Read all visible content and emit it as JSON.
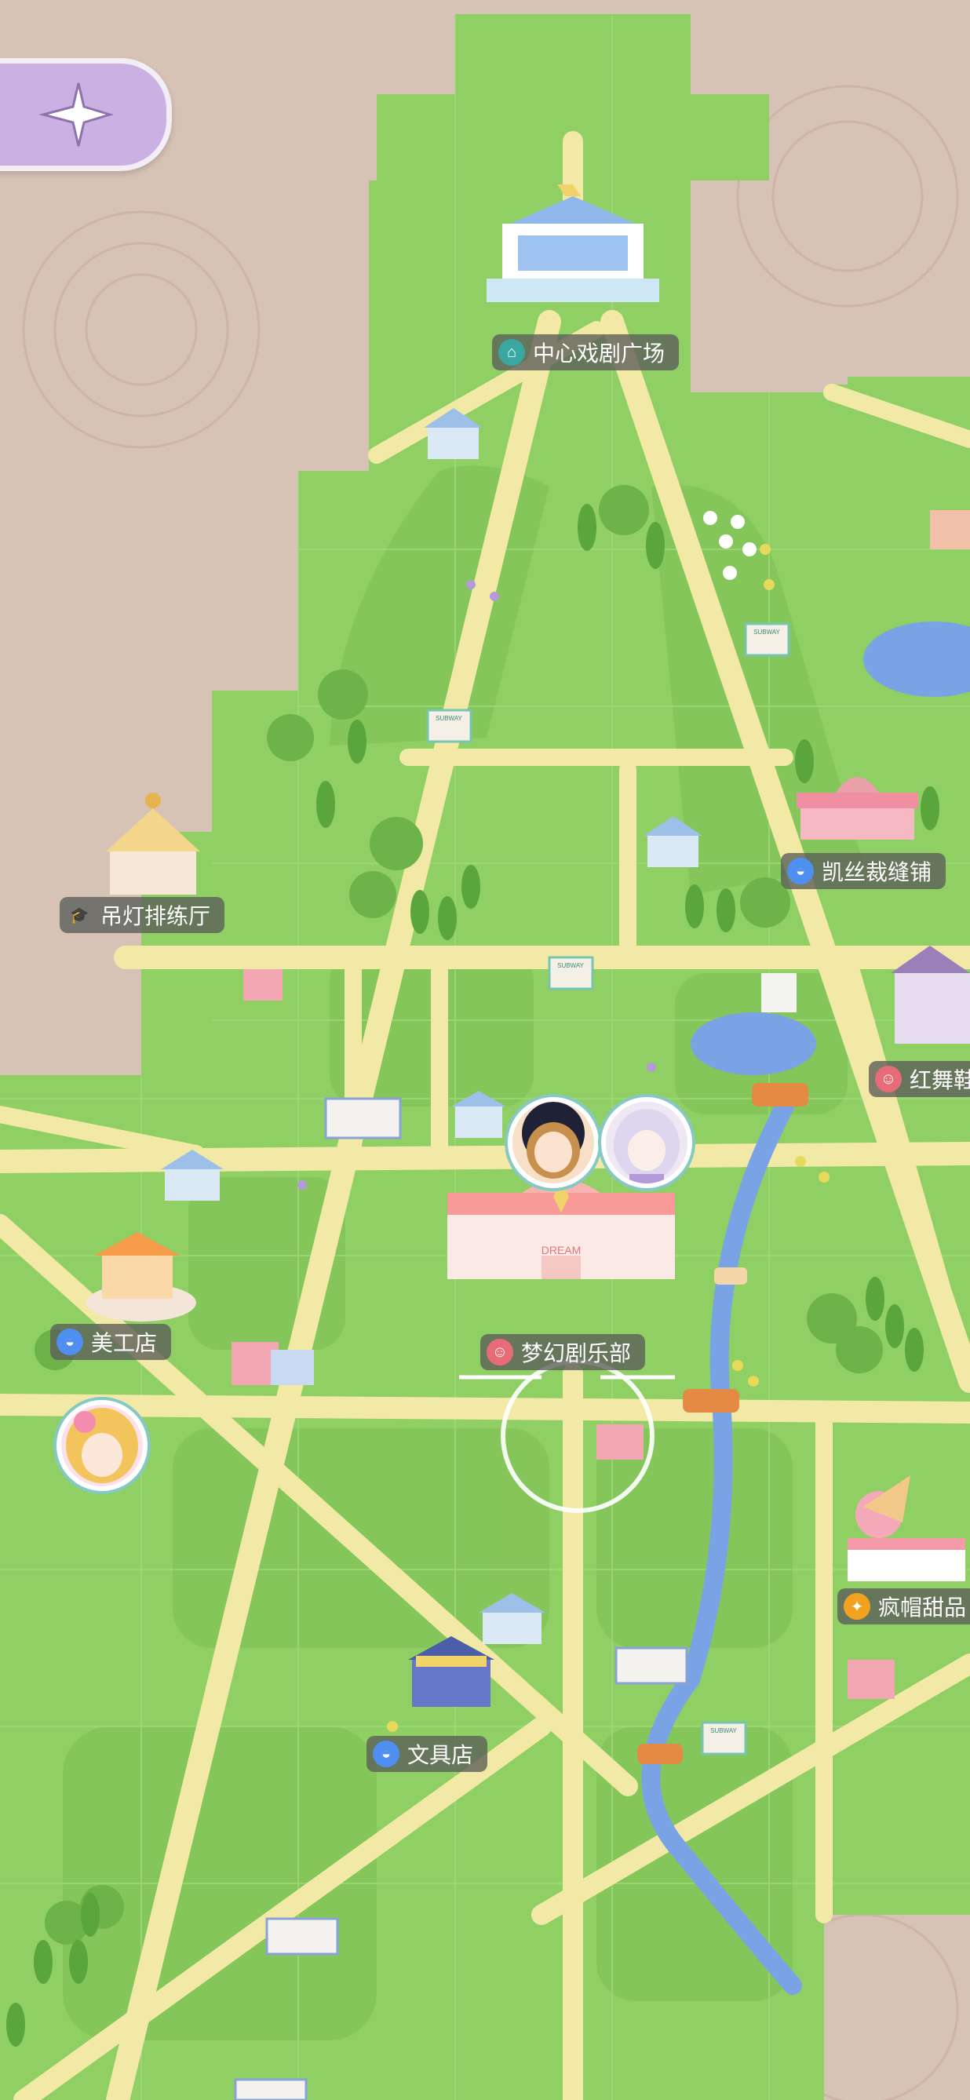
{
  "map": {
    "locations": [
      {
        "id": "central-theater",
        "name": "中心戏剧广场",
        "icon": "theater-building-icon",
        "category": "landmark"
      },
      {
        "id": "chandelier-hall",
        "name": "吊灯排练厅",
        "icon": "graduation-cap-icon",
        "category": "school"
      },
      {
        "id": "kaisi-tailor",
        "name": "凯丝裁缝铺",
        "icon": "shopping-bag-icon",
        "category": "shop"
      },
      {
        "id": "red-dance",
        "name": "红舞鞋",
        "icon": "drama-mask-icon",
        "category": "theater"
      },
      {
        "id": "art-shop",
        "name": "美工店",
        "icon": "shopping-bag-icon",
        "category": "shop"
      },
      {
        "id": "dream-club",
        "name": "梦幻剧乐部",
        "icon": "drama-mask-icon",
        "category": "theater"
      },
      {
        "id": "madhat-dessert",
        "name": "疯帽甜品",
        "icon": "fork-knife-icon",
        "category": "food"
      },
      {
        "id": "stationery",
        "name": "文具店",
        "icon": "shopping-bag-icon",
        "category": "shop"
      }
    ],
    "subway_sign": "SUBWAY",
    "club_sign": "DREAM",
    "characters": [
      "brown-haired-girl-avatar",
      "silver-haired-girl-avatar",
      "blonde-girl-avatar"
    ],
    "colors": {
      "grass": "#8fcf63",
      "road": "#f3e9a6",
      "river": "#7aa3e6",
      "border": "#d7c2b6",
      "back_button": "#cbb0e4"
    }
  },
  "ui": {
    "back_button_icon": "compass-star-icon"
  }
}
